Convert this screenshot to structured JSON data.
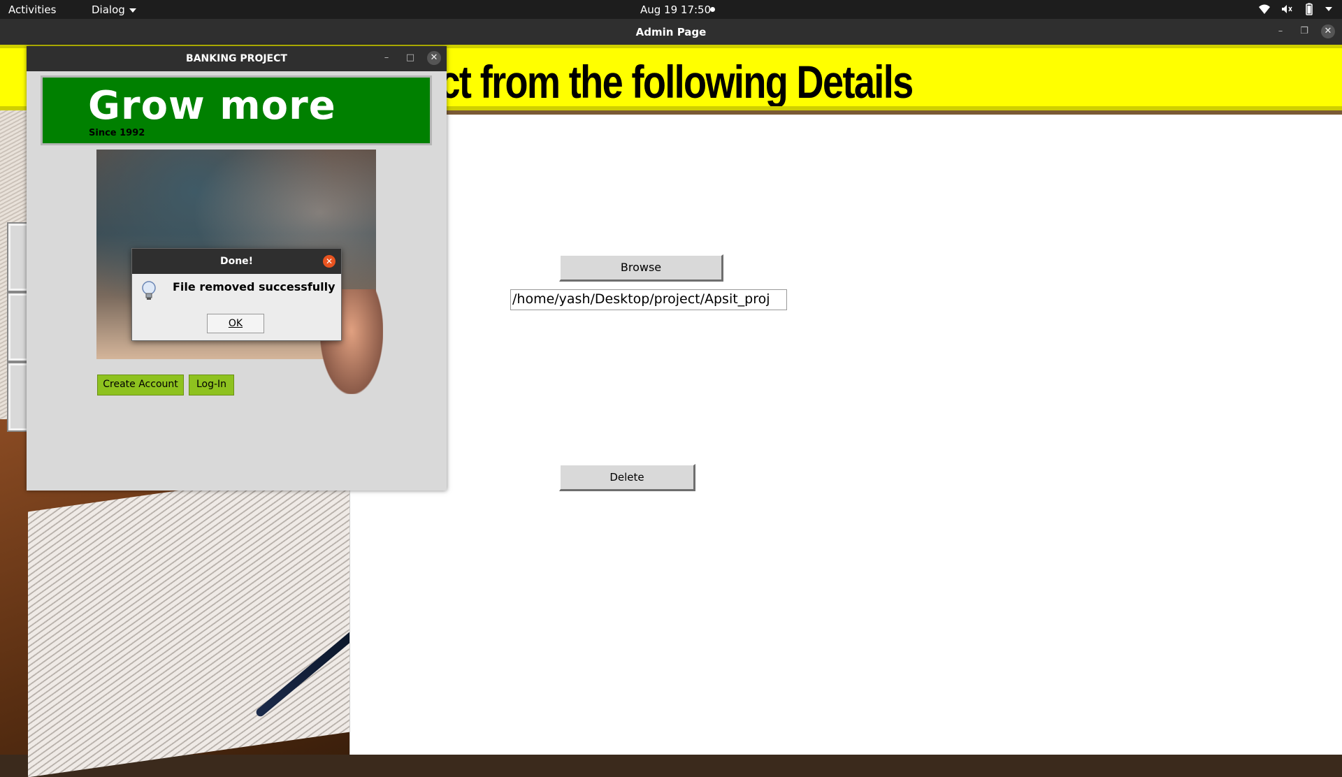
{
  "topbar": {
    "activities": "Activities",
    "app_menu": "Dialog",
    "clock": "Aug 19  17:50",
    "tray_icons": [
      "wifi-icon",
      "volume-muted-icon",
      "battery-icon",
      "system-menu-caret-icon"
    ]
  },
  "admin_window": {
    "title": "Admin Page",
    "banner_text": "ect from the following Details",
    "browse_label": "Browse",
    "path_value": "/home/yash/Desktop/project/Apsit_proj",
    "delete_label": "Delete"
  },
  "bank_window": {
    "title": "BANKING PROJECT",
    "headline": "Grow more",
    "since": "Since 1992",
    "create_account_label": "Create Account",
    "login_label": "Log-In",
    "colors": {
      "panel": "#008000",
      "buttons": "#8ec21f"
    }
  },
  "done_dialog": {
    "title": "Done!",
    "message": "File removed successfully",
    "ok_label": "OK",
    "icon": "lightbulb-info-icon"
  },
  "colors": {
    "banner": "#ffff00",
    "close_accent": "#e95420"
  }
}
